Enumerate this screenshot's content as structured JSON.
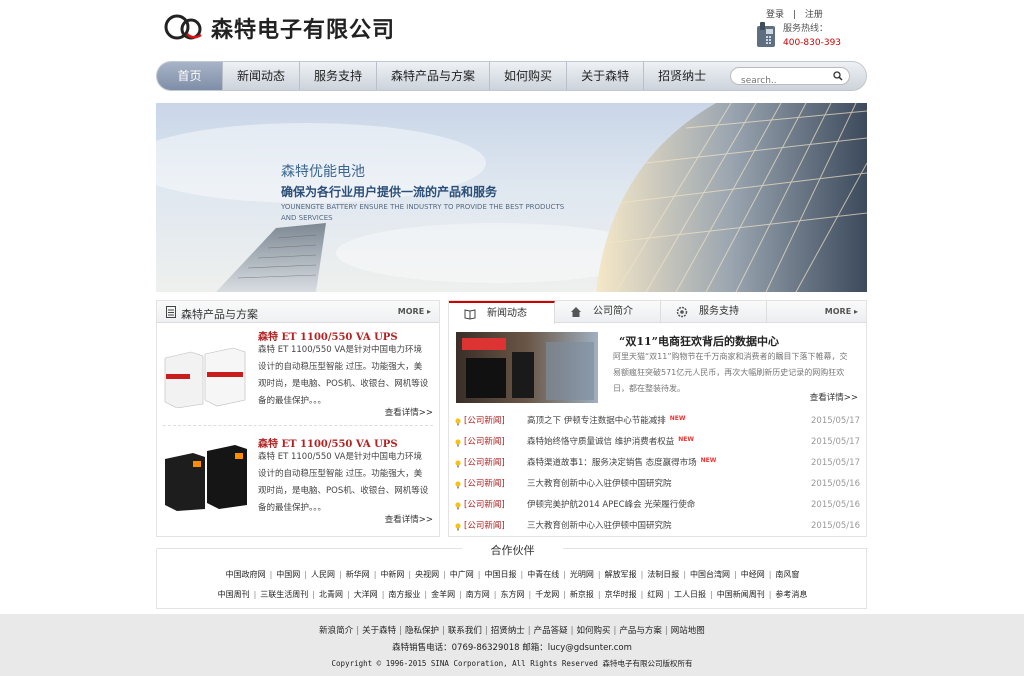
{
  "header": {
    "logo_text": "森特电子有限公司",
    "login": "登录",
    "divider": "|",
    "register": "注册",
    "hotline_label": "服务热线：",
    "hotline_number": "400-830-393"
  },
  "nav": {
    "items": [
      "首页",
      "新闻动态",
      "服务支持",
      "森特产品与方案",
      "如何购买",
      "关于森特",
      "招贤纳士"
    ],
    "search_placeholder": "search.."
  },
  "banner": {
    "title": "森特优能电池",
    "subtitle": "确保为各行业用户提供一流的产品和服务",
    "english": "YOUNENGTE BATTERY ENSURE THE INDUSTRY TO PROVIDE THE BEST PRODUCTS AND SERVICES"
  },
  "products_panel": {
    "title": "森特产品与方案",
    "more": "MORE",
    "items": [
      {
        "name": "森特 ET 1100/550 VA UPS",
        "desc": "森特 ET 1100/550 VA是针对中国电力环境设计的自动稳压型智能 过压。功能强大，美观时尚，是电脑、POS机、收银台、网机等设备的最佳保护。。。",
        "more": "查看详情>>"
      },
      {
        "name": "森特 ET 1100/550 VA UPS",
        "desc": "森特 ET 1100/550 VA是针对中国电力环境设计的自动稳压型智能 过压。功能强大，美观时尚，是电脑、POS机、收银台、网机等设备的最佳保护。。。",
        "more": "查看详情>>"
      }
    ]
  },
  "news_panel": {
    "tabs": [
      "新闻动态",
      "公司简介",
      "服务支持"
    ],
    "more": "MORE",
    "featured": {
      "title": "“双11”电商狂欢背后的数据中心",
      "desc": "阿里天猫“双11”购物节在千万商家和消费者的瞩目下落下帷幕，交易额瘋狂突破571亿元人民币，再次大幅刷新历史记录的网购狂欢日，都在整装待发。",
      "more": "查看详情>>"
    },
    "items": [
      {
        "cat": "[公司新闻]",
        "title": "高顶之下 伊顿专注数据中心节能减排",
        "hot": "NEW",
        "date": "2015/05/17"
      },
      {
        "cat": "[公司新闻]",
        "title": "森特始终恪守质量诚信 维护消费者权益",
        "hot": "NEW",
        "date": "2015/05/17"
      },
      {
        "cat": "[公司新闻]",
        "title": "森特渠道故事1：服务决定销售 态度赢得市场",
        "hot": "NEW",
        "date": "2015/05/17"
      },
      {
        "cat": "[公司新闻]",
        "title": "三大教育创新中心入驻伊顿中国研究院",
        "hot": "",
        "date": "2015/05/16"
      },
      {
        "cat": "[公司新闻]",
        "title": "伊顿完美护航2014 APEC峰会 光荣履行使命",
        "hot": "",
        "date": "2015/05/16"
      },
      {
        "cat": "[公司新闻]",
        "title": "三大教育创新中心入驻伊顿中国研究院",
        "hot": "",
        "date": "2015/05/16"
      }
    ]
  },
  "partners": {
    "title": "合作伙伴",
    "row1": [
      "中国政府网",
      "中国网",
      "人民网",
      "新华网",
      "中新网",
      "央视网",
      "中广网",
      "中国日报",
      "中青在线",
      "光明网",
      "解放军报",
      "法制日报",
      "中国台湾网",
      "中经网",
      "南风窗"
    ],
    "row2": [
      "中国周刊",
      "三联生活周刊",
      "北青网",
      "大洋网",
      "南方报业",
      "金羊网",
      "南方网",
      "东方网",
      "千龙网",
      "新京报",
      "京华时报",
      "红网",
      "工人日报",
      "中国新闻周刊",
      "参考消息"
    ]
  },
  "footer": {
    "links": [
      "新浪简介",
      "关于森特",
      "隐私保护",
      "联系我们",
      "招贤纳士",
      "产品答疑",
      "如何购买",
      "产品与方案",
      "网站地图"
    ],
    "contact": "森特销售电话：0769-86329018 邮箱：lucy@gdsunter.com",
    "copyright": "Copyright © 1996-2015 SINA Corporation, All Rights Reserved  森特电子有限公司版权所有"
  }
}
